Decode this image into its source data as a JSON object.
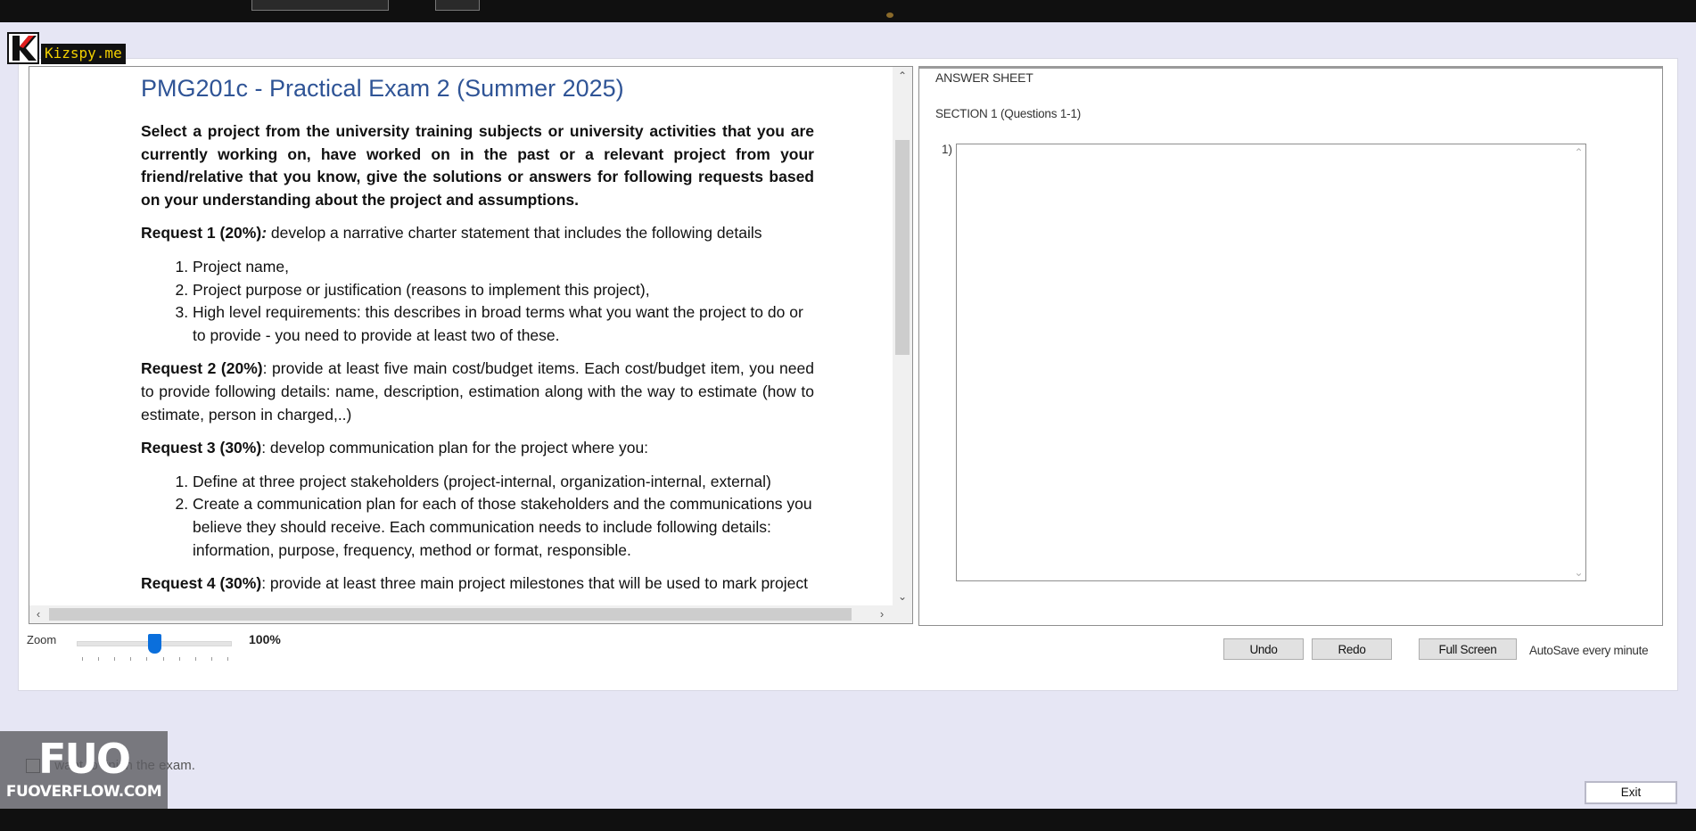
{
  "exam": {
    "title": "PMG201c - Practical Exam 2 (Summer 2025)",
    "intro": "Select a project from the university training subjects or university activities that you are currently working on, have worked on in the past or a relevant project from your friend/relative that you know, give the solutions or answers for following requests based on your understanding about the project and assumptions.",
    "request1": {
      "label": "Request 1 (20%)",
      "sep": ":",
      "text": " develop a narrative charter statement that includes the following details",
      "items": [
        "Project name,",
        "Project purpose or justification (reasons to implement this project),",
        "High level requirements: this describes in broad terms what you want the project to do or to provide - you need to provide at least two of these."
      ]
    },
    "request2": {
      "label": "Request 2 (20%)",
      "text": ": provide at least five main cost/budget items. Each cost/budget item, you need to provide following details: name, description, estimation along with the way to estimate (how to estimate, person in charged,..)"
    },
    "request3": {
      "label": "Request 3 (30%)",
      "text": ": develop communication plan for the project where you:",
      "items": [
        "Define at three project stakeholders (project-internal, organization-internal, external)",
        "Create a communication plan for each of those stakeholders and the communications you believe they should receive. Each communication needs to include following details: information, purpose, frequency, method or format, responsible."
      ]
    },
    "request4": {
      "label": "Request 4 (30%)",
      "text": ": provide at least three main project milestones that will be used to mark project"
    }
  },
  "answer_sheet": {
    "title": "ANSWER SHEET",
    "section": "SECTION 1 (Questions 1-1)",
    "question_number": "1)",
    "answer_value": ""
  },
  "zoom": {
    "label": "Zoom",
    "value": "100%",
    "slider_level_fraction": 0.5
  },
  "buttons": {
    "undo": "Undo",
    "redo": "Redo",
    "full_screen": "Full Screen",
    "exit": "Exit"
  },
  "autosave_note": "AutoSave every minute",
  "finish_label": "I want to finish the exam.",
  "watermarks": {
    "kizspy": "Kizspy.me",
    "fuo_logo": "FUO",
    "fuo_site": "FUOVERFLOW.COM"
  },
  "colors": {
    "accent": "#0a6fdc",
    "doc_title": "#2f5496",
    "background": "#e6e6f4"
  }
}
